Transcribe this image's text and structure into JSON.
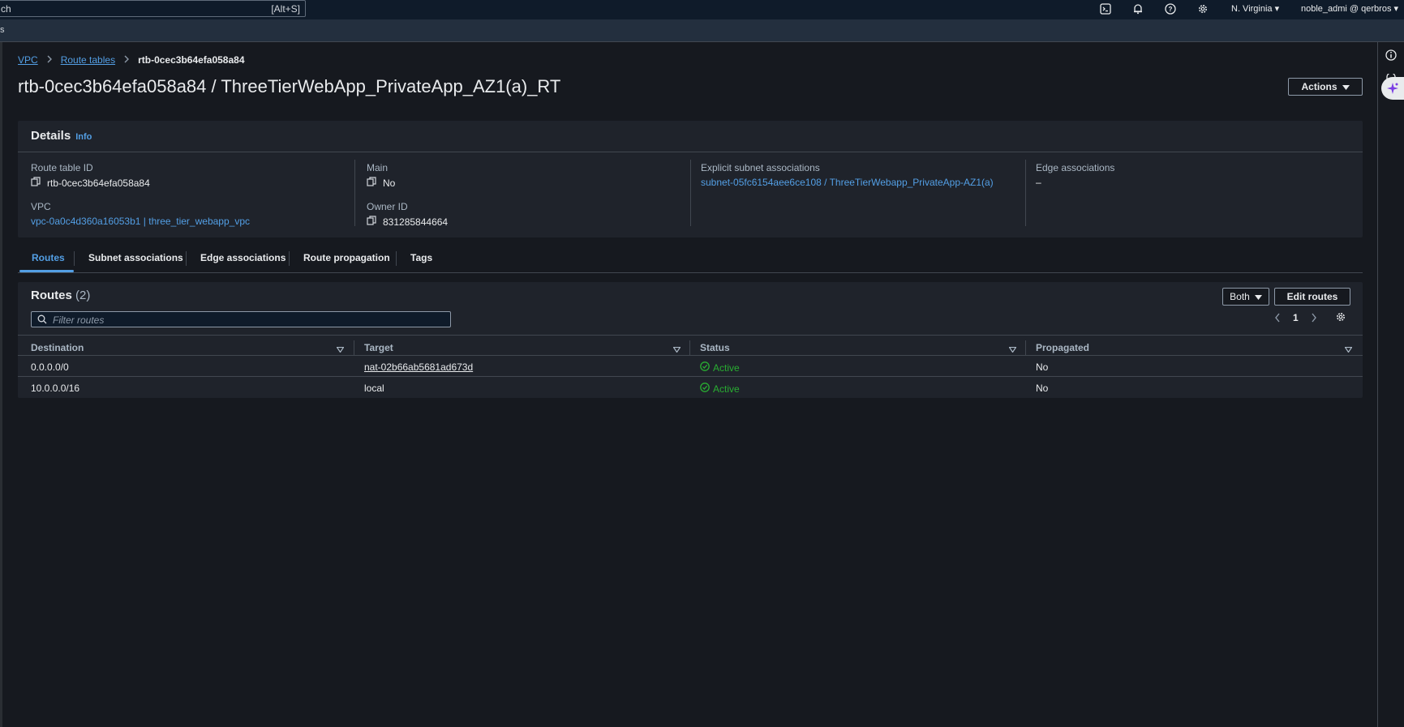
{
  "topbar": {
    "search_text": "ch",
    "search_shortcut": "[Alt+S]",
    "region": "N. Virginia",
    "account": "noble_admi @ qerbros"
  },
  "strip": {
    "text": "s"
  },
  "breadcrumb": {
    "items": [
      "VPC",
      "Route tables"
    ],
    "current": "rtb-0cec3b64efa058a84"
  },
  "page": {
    "title": "rtb-0cec3b64efa058a84 / ThreeTierWebApp_PrivateApp_AZ1(a)_RT",
    "actions_label": "Actions"
  },
  "details": {
    "heading": "Details",
    "info": "Info",
    "route_table_id_label": "Route table ID",
    "route_table_id": "rtb-0cec3b64efa058a84",
    "main_label": "Main",
    "main": "No",
    "explicit_label": "Explicit subnet associations",
    "explicit": "subnet-05fc6154aee6ce108 / ThreeTierWebapp_PrivateApp-AZ1(a)",
    "edge_label": "Edge associations",
    "edge": "–",
    "vpc_label": "VPC",
    "vpc": "vpc-0a0c4d360a16053b1 | three_tier_webapp_vpc",
    "owner_label": "Owner ID",
    "owner": "831285844664"
  },
  "tabs": [
    "Routes",
    "Subnet associations",
    "Edge associations",
    "Route propagation",
    "Tags"
  ],
  "routes": {
    "heading": "Routes",
    "count": "(2)",
    "filter_placeholder": "Filter routes",
    "both_label": "Both",
    "edit_label": "Edit routes",
    "page": "1",
    "columns": [
      "Destination",
      "Target",
      "Status",
      "Propagated"
    ],
    "rows": [
      {
        "destination": "0.0.0.0/0",
        "target": "nat-02b66ab5681ad673d",
        "status": "Active",
        "propagated": "No"
      },
      {
        "destination": "10.0.0.0/16",
        "target": "local",
        "status": "Active",
        "propagated": "No"
      }
    ]
  },
  "colors": {
    "accent": "#539fe5",
    "success": "#29ad32",
    "background": "#16191f",
    "panel": "#1f232b"
  }
}
